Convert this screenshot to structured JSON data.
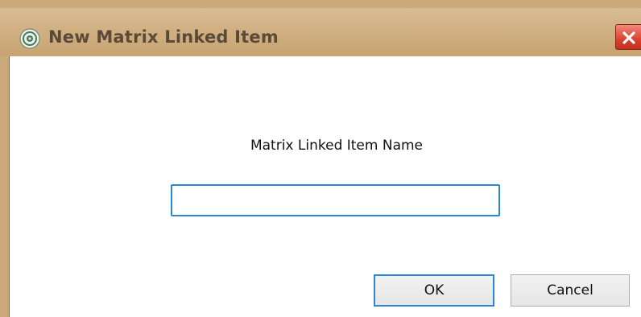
{
  "window": {
    "title": "New Matrix Linked Item",
    "icons": {
      "app": "app-logo-icon",
      "close": "close-icon"
    },
    "colors": {
      "titlebar": "#cfae80",
      "close_button": "#d9432f",
      "focus": "#2a86d8"
    }
  },
  "form": {
    "label": "Matrix Linked Item Name",
    "input_value": "",
    "input_placeholder": ""
  },
  "buttons": {
    "ok_label": "OK",
    "cancel_label": "Cancel"
  }
}
